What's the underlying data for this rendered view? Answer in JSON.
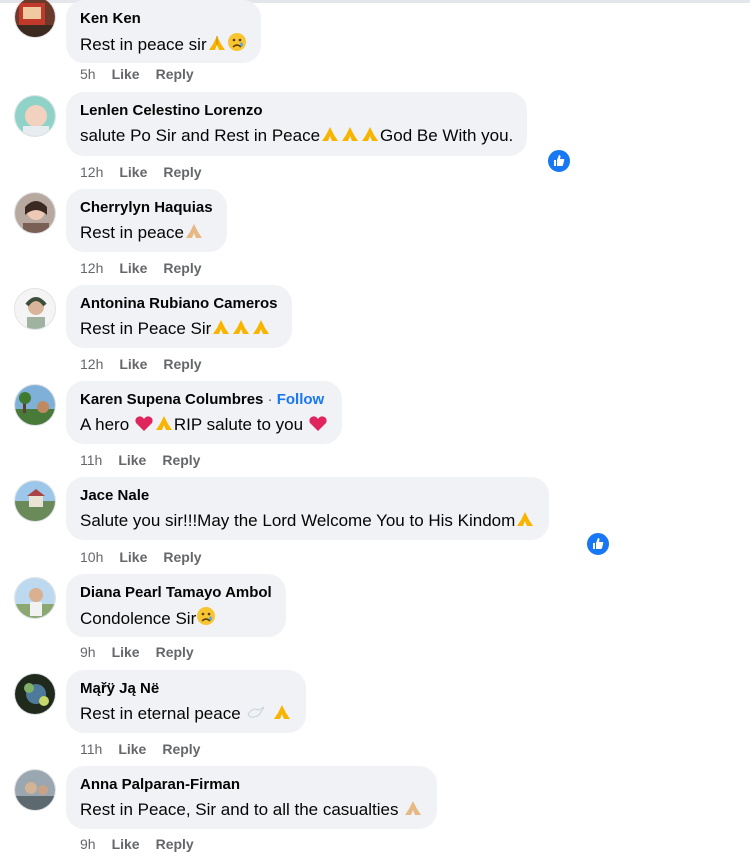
{
  "comments": [
    {
      "author": "Ken Ken",
      "follow": "",
      "text": "Rest in peace sir",
      "emoji": [
        "pray",
        "sad"
      ],
      "time": "5h",
      "like": "Like",
      "reply": "Reply",
      "reaction": false
    },
    {
      "author": "Lenlen Celestino Lorenzo",
      "follow": "",
      "text": "salute Po Sir and Rest in Peace",
      "emoji": [
        "pray",
        "pray",
        "pray"
      ],
      "text2": "God Be With you.",
      "time": "12h",
      "like": "Like",
      "reply": "Reply",
      "reaction": true
    },
    {
      "author": "Cherrylyn Haquias",
      "follow": "",
      "text": "Rest in peace",
      "emoji": [
        "pray"
      ],
      "time": "12h",
      "like": "Like",
      "reply": "Reply",
      "reaction": false
    },
    {
      "author": "Antonina Rubiano Cameros",
      "follow": "",
      "text": "Rest in Peace Sir",
      "emoji": [
        "pray",
        "pray",
        "pray"
      ],
      "time": "12h",
      "like": "Like",
      "reply": "Reply",
      "reaction": false
    },
    {
      "author": "Karen Supena Columbres",
      "follow": "Follow",
      "text": "A hero",
      "emoji": [
        "heart",
        "pray"
      ],
      "text2": "RIP salute to you",
      "emoji2": [
        "heart"
      ],
      "time": "11h",
      "like": "Like",
      "reply": "Reply",
      "reaction": false
    },
    {
      "author": "Jace Nale",
      "follow": "",
      "text": "Salute you sir!!!May the Lord Welcome You to His Kindom",
      "emoji": [
        "pray"
      ],
      "time": "10h",
      "like": "Like",
      "reply": "Reply",
      "reaction": true
    },
    {
      "author": "Diana Pearl Tamayo Ambol",
      "follow": "",
      "text": "Condolence Sir",
      "emoji": [
        "sad"
      ],
      "time": "9h",
      "like": "Like",
      "reply": "Reply",
      "reaction": false
    },
    {
      "author": "Mąřÿ Ją Në",
      "follow": "",
      "text": "Rest in eternal peace ",
      "emoji": [
        "dove",
        "pray"
      ],
      "time": "11h",
      "like": "Like",
      "reply": "Reply",
      "reaction": false
    },
    {
      "author": "Anna Palparan-Firman",
      "follow": "",
      "text": "Rest in Peace, Sir and to all the casualties ",
      "emoji": [
        "pray"
      ],
      "time": "9h",
      "like": "Like",
      "reply": "Reply",
      "reaction": false
    }
  ],
  "colors": {
    "bubble": "#f0f2f5",
    "meta": "#65676b",
    "accent": "#1877f2",
    "text": "#050505"
  }
}
